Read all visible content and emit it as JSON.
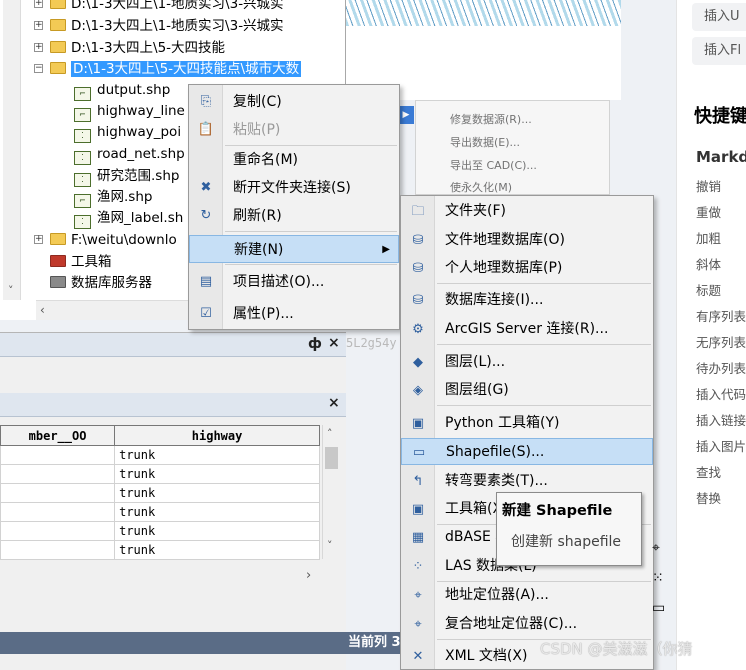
{
  "tree": {
    "rows": [
      {
        "label": "D:\\1-3大四上\\1-地质实习\\3-兴城实",
        "type": "folder"
      },
      {
        "label": "D:\\1-3大四上\\1-地质实习\\3-兴城实",
        "type": "folder"
      },
      {
        "label": "D:\\1-3大四上\\5-大四技能",
        "type": "folder"
      },
      {
        "label": "D:\\1-3大四上\\5-大四技能点\\城市大数",
        "type": "folder",
        "selected": true
      },
      {
        "label": "dutput.shp",
        "type": "shp"
      },
      {
        "label": "highway_line",
        "type": "shp"
      },
      {
        "label": "highway_poi",
        "type": "shp"
      },
      {
        "label": "road_net.shp",
        "type": "shp"
      },
      {
        "label": "研究范围.shp",
        "type": "shp"
      },
      {
        "label": "渔网.shp",
        "type": "shp"
      },
      {
        "label": "渔网_label.sh",
        "type": "shp"
      },
      {
        "label": "F:\\weitu\\downlo",
        "type": "folder"
      },
      {
        "label": "工具箱",
        "type": "toolbox"
      },
      {
        "label": "数据库服务器",
        "type": "server"
      }
    ]
  },
  "watermark_id": "5L2g54y",
  "table": {
    "columns": [
      "mber__OO",
      "highway"
    ],
    "rows": [
      [
        "",
        "trunk"
      ],
      [
        "",
        "trunk"
      ],
      [
        "",
        "trunk"
      ],
      [
        "",
        "trunk"
      ],
      [
        "",
        "trunk"
      ],
      [
        "",
        "trunk"
      ]
    ],
    "pin_label": "ф",
    "close_label": "×"
  },
  "statusbar": {
    "text": "当前列 3"
  },
  "context_menu": {
    "items": [
      {
        "label": "复制(C)",
        "icon": "copy-icon",
        "glyph": "⎘"
      },
      {
        "label": "粘贴(P)",
        "icon": "paste-icon",
        "glyph": "📋",
        "disabled": true
      },
      {
        "label": "重命名(M)",
        "icon": "",
        "glyph": ""
      },
      {
        "label": "断开文件夹连接(S)",
        "icon": "disconnect-folder-icon",
        "glyph": "✖"
      },
      {
        "label": "刷新(R)",
        "icon": "refresh-icon",
        "glyph": "↻"
      },
      {
        "label": "新建(N)",
        "icon": "",
        "glyph": "",
        "submenu": true,
        "highlighted": true
      },
      {
        "label": "项目描述(O)...",
        "icon": "item-description-icon",
        "glyph": "▤"
      },
      {
        "label": "属性(P)...",
        "icon": "properties-icon",
        "glyph": "☑"
      }
    ]
  },
  "background_menu": {
    "items": [
      "修复数据源(R)...",
      "导出数据(E)...",
      "导出至 CAD(C)...",
      "使永久化(M)"
    ]
  },
  "new_submenu": {
    "items": [
      {
        "label": "文件夹(F)",
        "icon": "folder-icon",
        "glyph": "🗀"
      },
      {
        "label": "文件地理数据库(O)",
        "icon": "file-geodatabase-icon",
        "glyph": "⛁"
      },
      {
        "label": "个人地理数据库(P)",
        "icon": "personal-geodatabase-icon",
        "glyph": "⛁"
      },
      {
        "label": "数据库连接(I)...",
        "icon": "database-connection-icon",
        "glyph": "⛁"
      },
      {
        "label": "ArcGIS Server 连接(R)...",
        "icon": "arcgis-server-icon",
        "glyph": "⚙"
      },
      {
        "label": "图层(L)...",
        "icon": "layer-icon",
        "glyph": "◆"
      },
      {
        "label": "图层组(G)",
        "icon": "group-layer-icon",
        "glyph": "◈"
      },
      {
        "label": "Python 工具箱(Y)",
        "icon": "python-toolbox-icon",
        "glyph": "▣"
      },
      {
        "label": "Shapefile(S)...",
        "icon": "shapefile-icon",
        "glyph": "▭",
        "highlighted": true
      },
      {
        "label": "转弯要素类(T)...",
        "icon": "turn-feature-class-icon",
        "glyph": "↰"
      },
      {
        "label": "工具箱(X)",
        "icon": "toolbox-icon",
        "glyph": "▣"
      },
      {
        "label": "dBASE 表(D)",
        "icon": "dbase-table-icon",
        "glyph": "▦"
      },
      {
        "label": "LAS 数据集(L)",
        "icon": "las-dataset-icon",
        "glyph": "⁘"
      },
      {
        "label": "地址定位器(A)...",
        "icon": "address-locator-icon",
        "glyph": "⌖"
      },
      {
        "label": "复合地址定位器(C)...",
        "icon": "composite-locator-icon",
        "glyph": "⌖"
      },
      {
        "label": "XML 文档(X)",
        "icon": "xml-document-icon",
        "glyph": "✕"
      }
    ]
  },
  "tooltip": {
    "title": "新建 Shapefile",
    "description": "创建新 shapefile"
  },
  "csdn_panel": {
    "chips": [
      "插入U",
      "插入Fl"
    ],
    "shortcut_title": "快捷键",
    "markdown_head": "Markd",
    "shortcuts": [
      "撤销",
      "重做",
      "加粗",
      "斜体",
      "标题",
      "有序列表",
      "无序列表",
      "待办列表",
      "插入代码",
      "插入链接",
      "插入图片",
      "查找",
      "替换"
    ]
  },
  "csdn_watermark": "CSDN @美滋滋（你猜",
  "colors": {
    "selection_blue": "#3399ff",
    "menu_highlight": "#c6dff6",
    "statusbar": "#5a6c86"
  }
}
